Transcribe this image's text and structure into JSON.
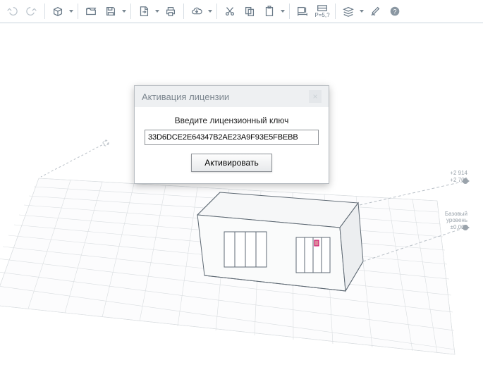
{
  "toolbar": {
    "ps_label": "P=5,?"
  },
  "dialog": {
    "title": "Активация лицензии",
    "prompt": "Введите лицензионный ключ",
    "key_value": "33D6DCE2E64347B2AE23A9F93E5FBEBB",
    "activate_label": "Активировать",
    "close_glyph": "×"
  },
  "scene": {
    "marker_top_label1": "+2 914",
    "marker_top_label2": "+2 700",
    "marker_base_label1": "Базовый",
    "marker_base_label2": "уровень",
    "marker_base_value": "±0,000"
  }
}
